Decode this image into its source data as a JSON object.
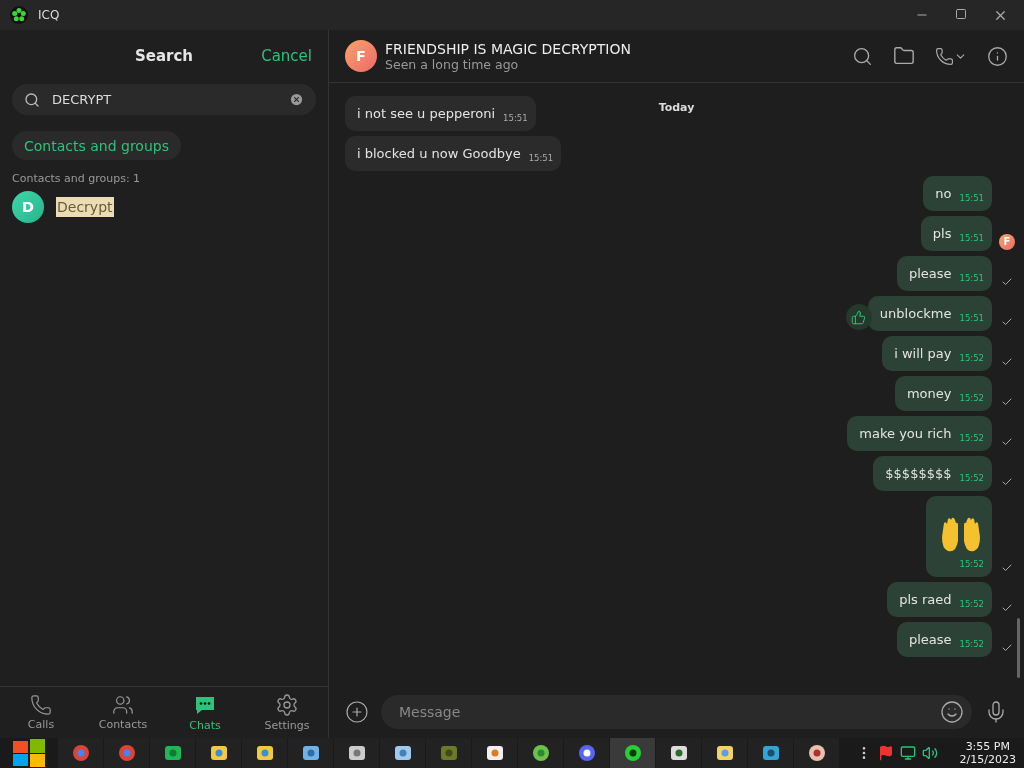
{
  "window": {
    "title": "ICQ"
  },
  "search": {
    "title": "Search",
    "cancel": "Cancel",
    "value": "DECRYPT",
    "filter": "Contacts and groups",
    "count_label": "Contacts and groups: 1",
    "results": [
      {
        "initial": "D",
        "name": "Decrypt",
        "selected": true
      }
    ]
  },
  "nav": [
    {
      "label": "Calls",
      "kind": "calls",
      "selected": false
    },
    {
      "label": "Contacts",
      "kind": "contacts",
      "selected": false
    },
    {
      "label": "Chats",
      "kind": "chats",
      "selected": true
    },
    {
      "label": "Settings",
      "kind": "settings",
      "selected": false
    }
  ],
  "chat": {
    "initial": "F",
    "title": "FRIENDSHIP IS MAGIC DECRYPTION",
    "status": "Seen a long time ago",
    "date_label": "Today",
    "messages": [
      {
        "kind": "text",
        "outgoing": false,
        "text": "i not see u pepperoni",
        "time": "15:51",
        "liked": false
      },
      {
        "kind": "text",
        "outgoing": false,
        "text": "i blocked u now Goodbye",
        "time": "15:51",
        "liked": false
      },
      {
        "kind": "text",
        "outgoing": true,
        "text": "no",
        "time": "15:51",
        "delivered": false,
        "liked": false
      },
      {
        "kind": "text",
        "outgoing": true,
        "text": "pls",
        "time": "15:51",
        "delivered": false,
        "seen_initial": "F",
        "liked": false
      },
      {
        "kind": "text",
        "outgoing": true,
        "text": "please",
        "time": "15:51",
        "delivered": true,
        "liked": false
      },
      {
        "kind": "text",
        "outgoing": true,
        "text": "unblockme",
        "time": "15:51",
        "delivered": true,
        "liked": true
      },
      {
        "kind": "text",
        "outgoing": true,
        "text": "i will pay",
        "time": "15:52",
        "delivered": true,
        "liked": false
      },
      {
        "kind": "text",
        "outgoing": true,
        "text": "money",
        "time": "15:52",
        "delivered": true,
        "liked": false
      },
      {
        "kind": "text",
        "outgoing": true,
        "text": "make you rich",
        "time": "15:52",
        "delivered": true,
        "liked": false
      },
      {
        "kind": "text",
        "outgoing": true,
        "text": "$$$$$$$$",
        "time": "15:52",
        "delivered": true,
        "liked": false
      },
      {
        "kind": "sticker",
        "outgoing": true,
        "time": "15:52",
        "delivered": true,
        "liked": false
      },
      {
        "kind": "text",
        "outgoing": true,
        "text": "pls raed",
        "time": "15:52",
        "delivered": true,
        "liked": false
      },
      {
        "kind": "text",
        "outgoing": true,
        "text": "please",
        "time": "15:52",
        "delivered": true,
        "liked": false
      }
    ],
    "composer": {
      "placeholder": "Message"
    }
  },
  "taskbar": {
    "apps": [
      {
        "kind": "chrome",
        "selected": false
      },
      {
        "kind": "chrome",
        "selected": false
      },
      {
        "kind": "chat",
        "selected": false
      },
      {
        "kind": "people",
        "selected": false
      },
      {
        "kind": "people",
        "selected": false
      },
      {
        "kind": "users",
        "selected": false
      },
      {
        "kind": "printer",
        "selected": false
      },
      {
        "kind": "image",
        "selected": false
      },
      {
        "kind": "plant",
        "selected": false
      },
      {
        "kind": "java",
        "selected": false
      },
      {
        "kind": "ball",
        "selected": false
      },
      {
        "kind": "discord",
        "selected": false
      },
      {
        "kind": "icq",
        "selected": true
      },
      {
        "kind": "monitor",
        "selected": false
      },
      {
        "kind": "folder",
        "selected": false
      },
      {
        "kind": "pen",
        "selected": false
      },
      {
        "kind": "gauge",
        "selected": false
      }
    ],
    "time": "3:55 PM",
    "date": "2/15/2023"
  }
}
